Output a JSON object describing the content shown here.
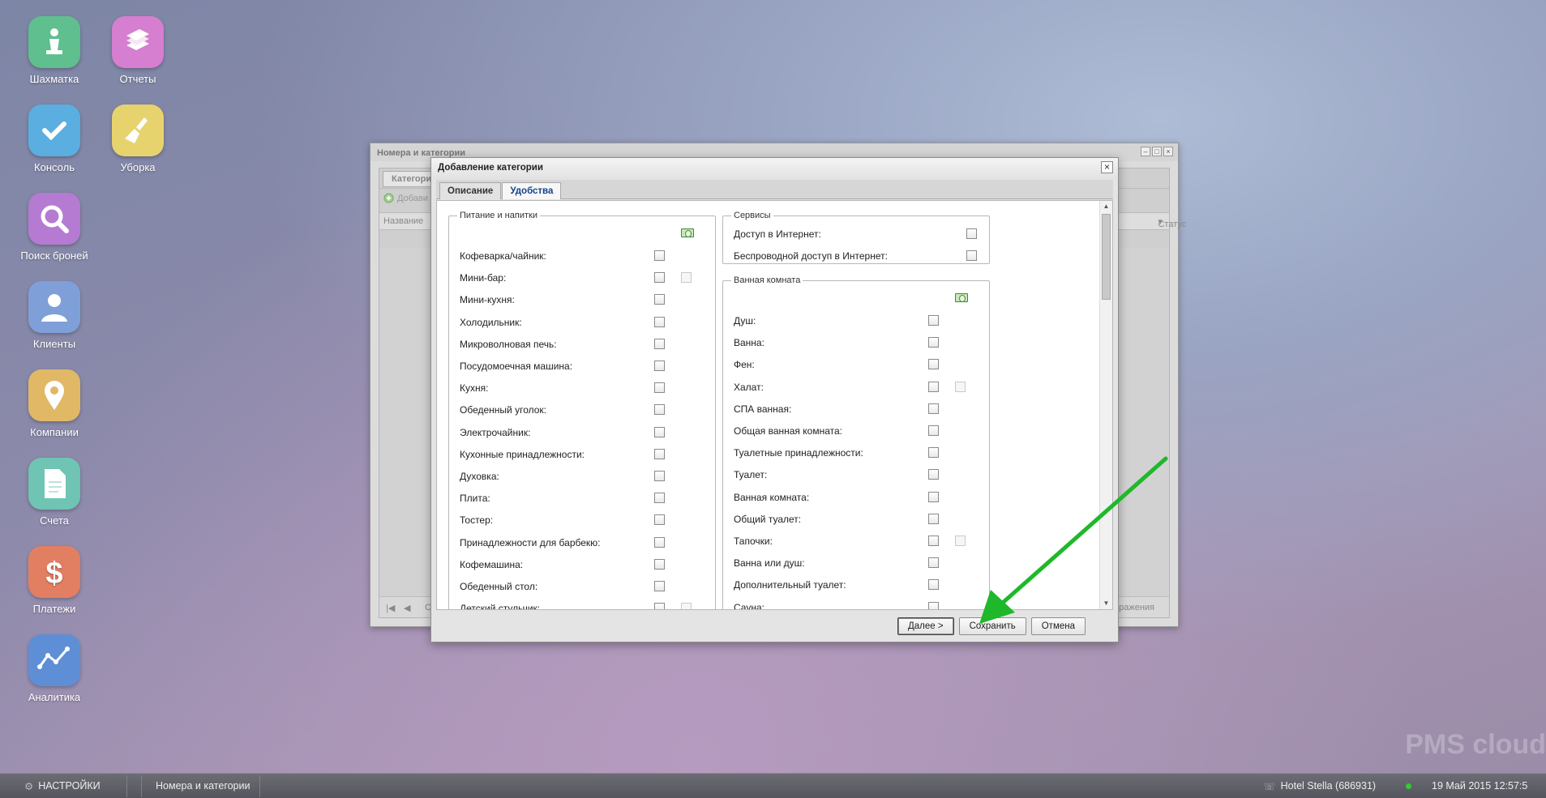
{
  "desktop_icons": [
    {
      "label": "Шахматка",
      "color": "#5fbf8f",
      "icon": "chess-pawn-icon"
    },
    {
      "label": "Отчеты",
      "color": "#d67ecf",
      "icon": "books-icon"
    },
    {
      "label": "Консоль",
      "color": "#5aaee0",
      "icon": "checkmark-icon"
    },
    {
      "label": "Уборка",
      "color": "#e7d36e",
      "icon": "broom-icon"
    },
    {
      "label": "Поиск броней",
      "color": "#b57bd2",
      "icon": "magnifier-icon"
    },
    {
      "label": "Клиенты",
      "color": "#7f9fd9",
      "icon": "person-icon"
    },
    {
      "label": "Компании",
      "color": "#e0b866",
      "icon": "map-pin-icon"
    },
    {
      "label": "Счета",
      "color": "#6fc4b3",
      "icon": "document-icon"
    },
    {
      "label": "Платежи",
      "color": "#e27f63",
      "icon": "dollar-icon"
    },
    {
      "label": "Аналитика",
      "color": "#5e8fd6",
      "icon": "line-chart-icon"
    }
  ],
  "background_window": {
    "title": "Номера и категории",
    "tab": "Категори",
    "add_button": "Добави",
    "col_name": "Название",
    "col_status": "Статус",
    "pager_right": "ображения",
    "pager_left": "С"
  },
  "dialog": {
    "title": "Добавление категории",
    "tabs": [
      "Описание",
      "Удобства"
    ],
    "active_tab": "Удобства",
    "food_group": {
      "legend": "Питание и напитки",
      "items": [
        {
          "label": "Кофеварка/чайник:",
          "extra": false
        },
        {
          "label": "Мини-бар:",
          "extra": true
        },
        {
          "label": "Мини-кухня:",
          "extra": false
        },
        {
          "label": "Холодильник:",
          "extra": false
        },
        {
          "label": "Микроволновая печь:",
          "extra": false
        },
        {
          "label": "Посудомоечная машина:",
          "extra": false
        },
        {
          "label": "Кухня:",
          "extra": false
        },
        {
          "label": "Обеденный уголок:",
          "extra": false
        },
        {
          "label": "Электрочайник:",
          "extra": false
        },
        {
          "label": "Кухонные принадлежности:",
          "extra": false
        },
        {
          "label": "Духовка:",
          "extra": false
        },
        {
          "label": "Плита:",
          "extra": false
        },
        {
          "label": "Тостер:",
          "extra": false
        },
        {
          "label": "Принадлежности для барбекю:",
          "extra": false
        },
        {
          "label": "Кофемашина:",
          "extra": false
        },
        {
          "label": "Обеденный стол:",
          "extra": false
        },
        {
          "label": "Детский стульчик:",
          "extra": true
        }
      ]
    },
    "services_group": {
      "legend": "Сервисы",
      "items": [
        {
          "label": "Доступ в Интернет:"
        },
        {
          "label": "Беспроводной доступ в Интернет:"
        }
      ]
    },
    "bath_group": {
      "legend": "Ванная комната",
      "items": [
        {
          "label": "Душ:",
          "extra": false
        },
        {
          "label": "Ванна:",
          "extra": false
        },
        {
          "label": "Фен:",
          "extra": false
        },
        {
          "label": "Халат:",
          "extra": true
        },
        {
          "label": "СПА ванная:",
          "extra": false
        },
        {
          "label": "Общая ванная комната:",
          "extra": false
        },
        {
          "label": "Туалетные принадлежности:",
          "extra": false
        },
        {
          "label": "Туалет:",
          "extra": false
        },
        {
          "label": "Ванная комната:",
          "extra": false
        },
        {
          "label": "Общий туалет:",
          "extra": false
        },
        {
          "label": "Тапочки:",
          "extra": true
        },
        {
          "label": "Ванна или душ:",
          "extra": false
        },
        {
          "label": "Дополнительный туалет:",
          "extra": false
        },
        {
          "label": "Сауна:",
          "extra": false
        }
      ]
    },
    "buttons": {
      "next": "Далее >",
      "save": "Сохранить",
      "cancel": "Отмена"
    }
  },
  "taskbar": {
    "settings": "НАСТРОЙКИ",
    "window_item": "Номера и категории",
    "hotel": "Hotel Stella (686931)",
    "datetime": "19 Май 2015 12:57:5"
  },
  "watermark": "PMS cloud",
  "arrow_color": "#1fb82a"
}
